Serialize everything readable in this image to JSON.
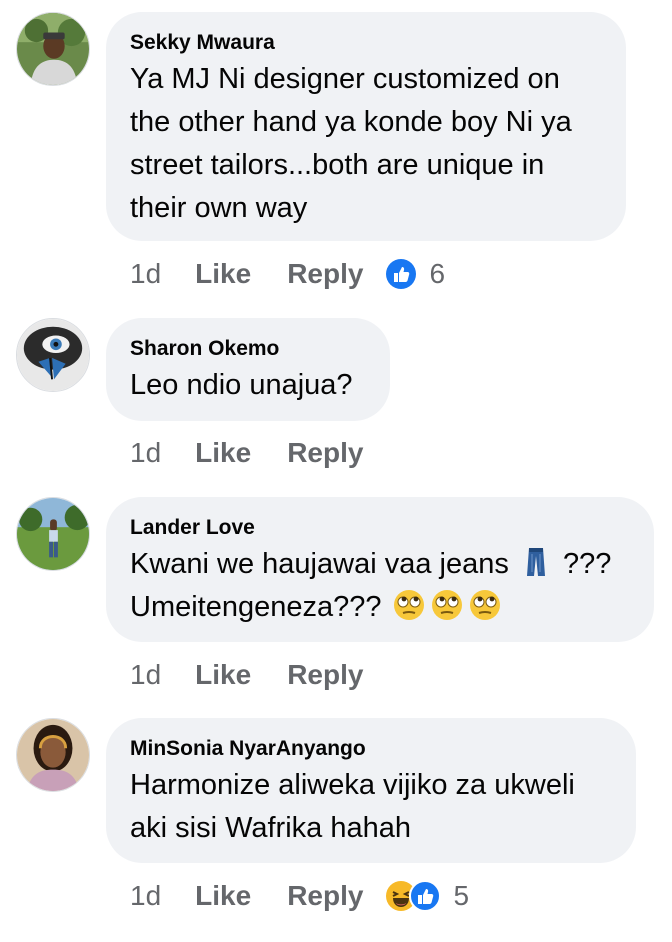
{
  "comments": [
    {
      "author": "Sekky Mwaura",
      "text": "Ya MJ Ni designer customized on the other hand ya konde boy Ni ya street tailors...both are unique in their own way",
      "time": "1d",
      "like_label": "Like",
      "reply_label": "Reply",
      "reactions": [
        "like"
      ],
      "reaction_count": "6"
    },
    {
      "author": "Sharon Okemo",
      "text": "Leo ndio unajua?",
      "time": "1d",
      "like_label": "Like",
      "reply_label": "Reply"
    },
    {
      "author": "Lander Love",
      "text_line1_before": "Kwani we haujawai vaa jeans ",
      "text_line1_after": " ???",
      "text_line2": "Umeitengeneza??? ",
      "emojis": [
        "jeans",
        "eye-roll",
        "eye-roll",
        "eye-roll"
      ],
      "time": "1d",
      "like_label": "Like",
      "reply_label": "Reply"
    },
    {
      "author": "MinSonia NyarAnyango",
      "text": "Harmonize aliweka vijiko za ukweli aki sisi Wafrika hahah",
      "time": "1d",
      "like_label": "Like",
      "reply_label": "Reply",
      "reactions": [
        "haha",
        "like"
      ],
      "reaction_count": "5"
    }
  ],
  "colors": {
    "bubble": "#f0f2f5",
    "text": "#050505",
    "secondary": "#65676b",
    "like_blue": "#1877f2",
    "emoji_yellow": "#f7b928"
  }
}
